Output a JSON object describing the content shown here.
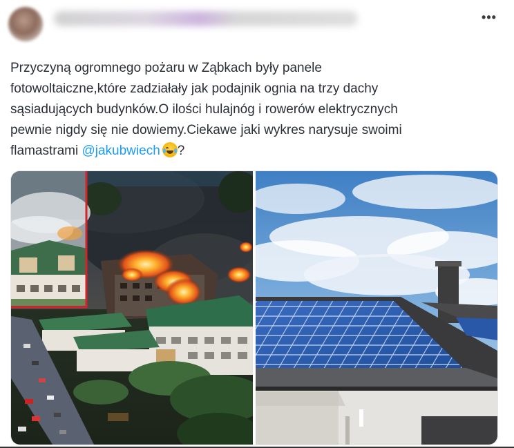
{
  "post": {
    "more_label": "•••",
    "text_line1": "Przyczyną ogromnego pożaru w Ząbkach były panele",
    "text_line2": "fotowoltaiczne,które zadziałały jak podajnik ognia na trzy dachy",
    "text_line3": "sąsiadujących budynków.O ilości hulajnóg i rowerów elektrycznych",
    "text_line4": "pewnie nigdy się nie dowiemy.Ciekawe jaki wykres narysuje swoimi",
    "text_line5_pre": "flamastrami ",
    "mention": "@jakubwiech",
    "text_line5_post": "?",
    "emoji": "face-with-tears-of-joy"
  },
  "media": {
    "left_image": "aerial-fire-photo",
    "right_image": "solar-panels-roof-photo"
  },
  "colors": {
    "text": "#2a2f36",
    "mention": "#1d9bf0",
    "inset_border": "#d4232b"
  }
}
